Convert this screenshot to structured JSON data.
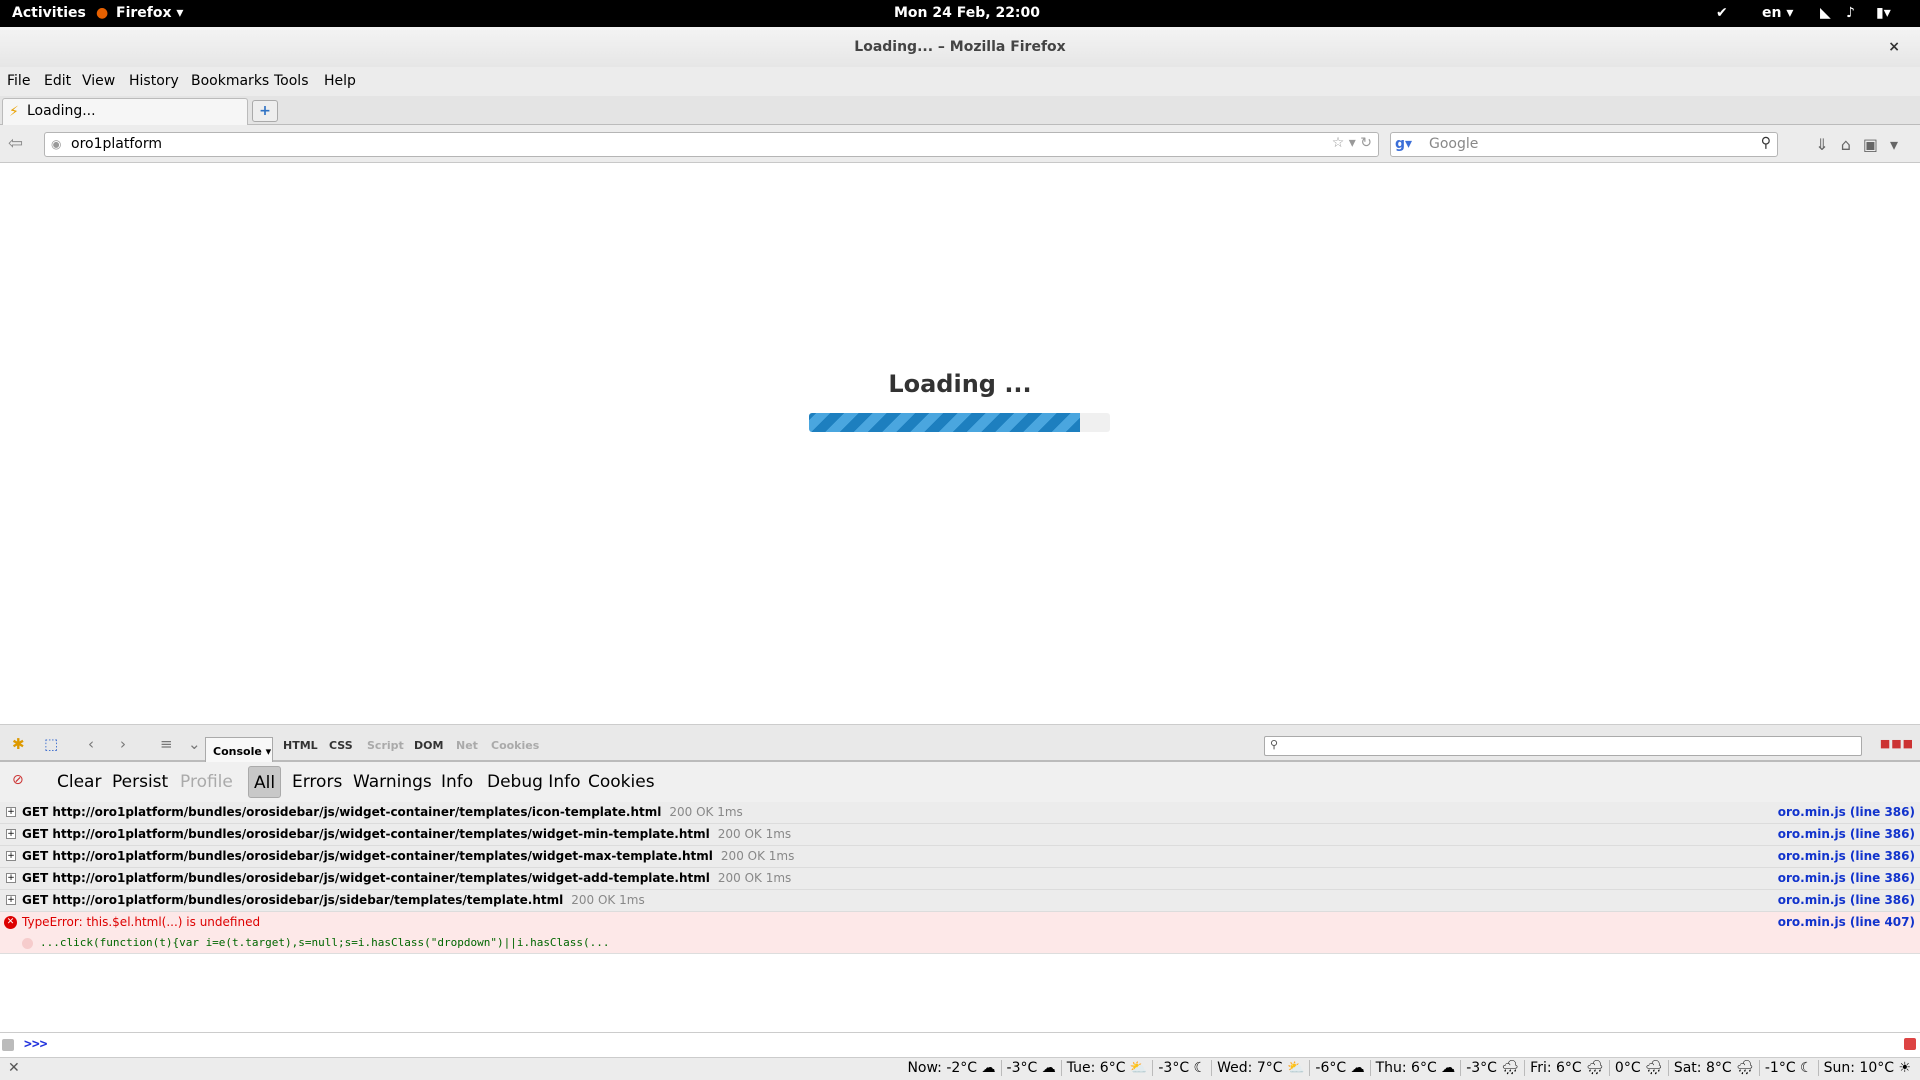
{
  "topbar": {
    "activities": "Activities",
    "app": "Firefox ▾",
    "clock": "Mon 24 Feb, 22:00",
    "lang": "en ▾"
  },
  "window": {
    "title": "Loading... – Mozilla Firefox",
    "close": "×"
  },
  "menu": [
    "File",
    "Edit",
    "View",
    "History",
    "Bookmarks",
    "Tools",
    "Help"
  ],
  "tab": {
    "label": "Loading...",
    "new": "+"
  },
  "nav": {
    "url": "oro1platform",
    "search_placeholder": "Google"
  },
  "page": {
    "loading_text": "Loading ...",
    "progress_percent": 90,
    "progress_color": "#1d7fbf"
  },
  "devtools": {
    "panels": [
      "Console ▾",
      "HTML",
      "CSS",
      "Script",
      "DOM",
      "Net",
      "Cookies"
    ],
    "filters": [
      "Clear",
      "Persist",
      "Profile",
      "All",
      "Errors",
      "Warnings",
      "Info",
      "Debug Info",
      "Cookies"
    ],
    "rows": [
      {
        "text": "GET http://oro1platform/bundles/orosidebar/js/widget-container/templates/icon-template.html",
        "status": "200 OK 1ms",
        "source": "oro.min.js (line 386)"
      },
      {
        "text": "GET http://oro1platform/bundles/orosidebar/js/widget-container/templates/widget-min-template.html",
        "status": "200 OK 1ms",
        "source": "oro.min.js (line 386)"
      },
      {
        "text": "GET http://oro1platform/bundles/orosidebar/js/widget-container/templates/widget-max-template.html",
        "status": "200 OK 1ms",
        "source": "oro.min.js (line 386)"
      },
      {
        "text": "GET http://oro1platform/bundles/orosidebar/js/widget-container/templates/widget-add-template.html",
        "status": "200 OK 1ms",
        "source": "oro.min.js (line 386)"
      },
      {
        "text": "GET http://oro1platform/bundles/orosidebar/js/sidebar/templates/template.html",
        "status": "200 OK 1ms",
        "source": "oro.min.js (line 386)"
      }
    ],
    "error": {
      "message": "TypeError: this.$el.html(...) is undefined",
      "source": "oro.min.js (line 407)",
      "code": "...click(function(t){var i=e(t.target),s=null;s=i.hasClass(\"dropdown\")||i.hasClass(..."
    },
    "prompt": ">>>"
  },
  "status": {
    "weather": [
      "Now: -2°C ☁",
      "-3°C ☁",
      "Tue: 6°C ⛅",
      "-3°C ☾",
      "Wed: 7°C ⛅",
      "-6°C ☁",
      "Thu: 6°C ☁",
      "-3°C 🌧",
      "Fri: 6°C 🌧",
      "0°C 🌧",
      "Sat: 8°C 🌧",
      "-1°C ☾",
      "Sun: 10°C ☀"
    ]
  }
}
